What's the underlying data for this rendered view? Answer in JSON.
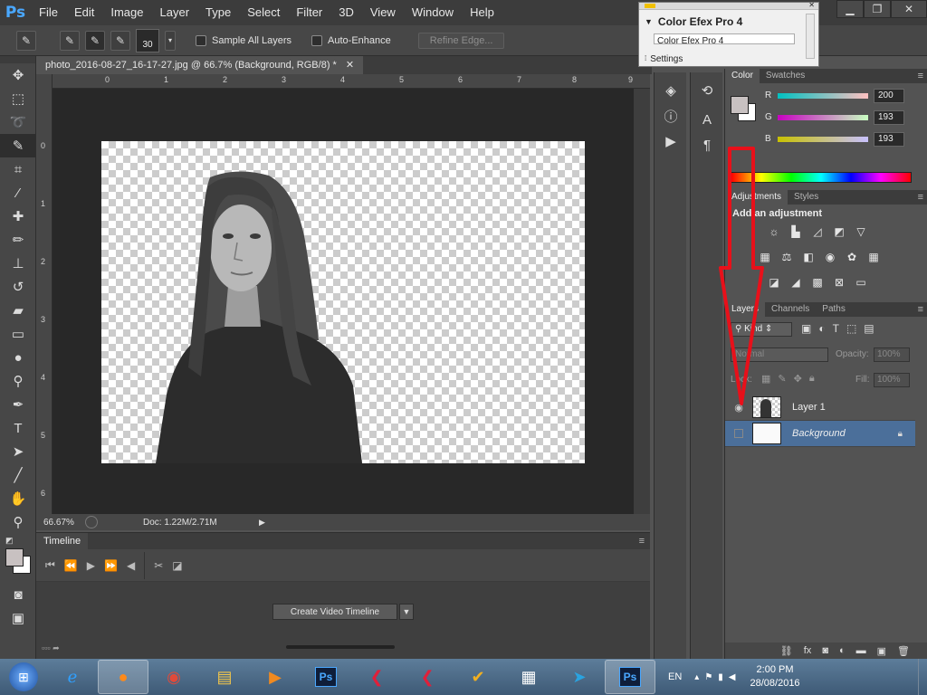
{
  "menubar": {
    "logo": "Ps",
    "items": [
      "File",
      "Edit",
      "Image",
      "Layer",
      "Type",
      "Select",
      "Filter",
      "3D",
      "View",
      "Window",
      "Help"
    ]
  },
  "options": {
    "brush_size": "30",
    "sample_all_layers": "Sample All Layers",
    "auto_enhance": "Auto-Enhance",
    "refine_edge": "Refine Edge..."
  },
  "document": {
    "tab_title": "photo_2016-08-27_16-17-27.jpg @ 66.7% (Background, RGB/8) *",
    "ruler_h": [
      "0",
      "1",
      "2",
      "3",
      "4",
      "5",
      "6",
      "7",
      "8",
      "9"
    ],
    "ruler_v": [
      "0",
      "1",
      "2",
      "3",
      "4",
      "5",
      "6"
    ],
    "zoom": "66.67%",
    "doc_size": "Doc: 1.22M/2.71M"
  },
  "timeline": {
    "tab": "Timeline",
    "create_button": "Create Video Timeline"
  },
  "efex": {
    "title": "Color Efex Pro 4",
    "subtitle": "Color Efex Pro 4",
    "settings": "Settings"
  },
  "color_panel": {
    "tabs": [
      "Color",
      "Swatches"
    ],
    "r_label": "R",
    "g_label": "G",
    "b_label": "B",
    "r_value": "200",
    "g_value": "193",
    "b_value": "193"
  },
  "adjustments_panel": {
    "tabs": [
      "Adjustments",
      "Styles"
    ],
    "heading": "Add an adjustment"
  },
  "layers_panel": {
    "tabs": [
      "Layers",
      "Channels",
      "Paths"
    ],
    "kind": "Kind",
    "blend_mode": "Normal",
    "opacity_label": "Opacity:",
    "opacity_value": "100%",
    "lock_label": "Lock:",
    "fill_label": "Fill:",
    "fill_value": "100%",
    "layers": [
      {
        "name": "Layer 1"
      },
      {
        "name": "Background"
      }
    ]
  },
  "taskbar": {
    "language": "EN",
    "time": "2:00 PM",
    "date": "28/08/2016"
  },
  "colors": {
    "accent_red": "#e8101a",
    "selected_layer": "#4b6f9a"
  }
}
